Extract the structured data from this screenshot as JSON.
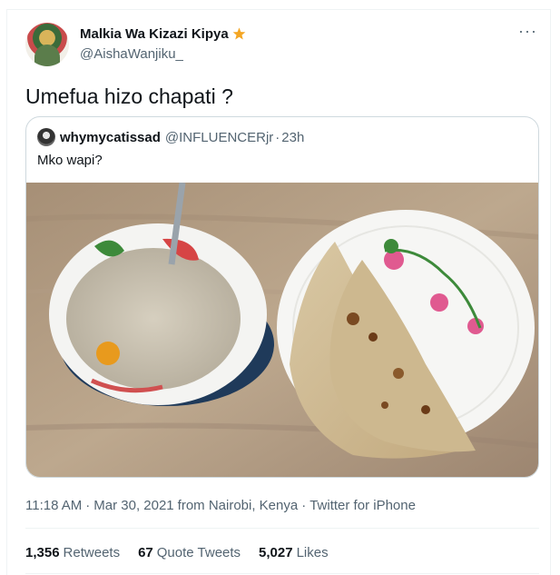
{
  "author": {
    "display_name": "Malkia Wa Kizazi Kipya",
    "handle": "@AishaWanjiku_",
    "badge_icon": "star-icon"
  },
  "more_icon": "···",
  "tweet": {
    "text": "Umefua hizo chapati ?"
  },
  "quoted": {
    "display_name": "whymycatissad",
    "handle": "@INFLUENCERjr",
    "separator": "·",
    "time": "23h",
    "text": "Mko wapi?",
    "photo_alt": "bowl of tea and chapati on a plate"
  },
  "meta": {
    "time": "11:18 AM",
    "date": "Mar 30, 2021",
    "location": "from Nairobi, Kenya",
    "source": "Twitter for iPhone",
    "separator": "·"
  },
  "stats": {
    "retweets_count": "1,356",
    "retweets_label": "Retweets",
    "quotes_count": "67",
    "quotes_label": "Quote Tweets",
    "likes_count": "5,027",
    "likes_label": "Likes"
  },
  "colors": {
    "secondary_text": "#536471",
    "border": "#cfd9de",
    "badge": "#f4a623"
  }
}
